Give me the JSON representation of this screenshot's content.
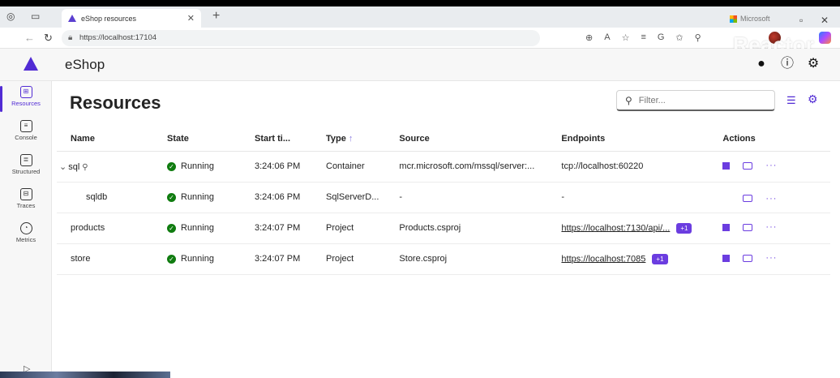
{
  "browser": {
    "tab_title": "eShop resources",
    "url": "https://localhost:17104",
    "profile_label": "Microsoft",
    "watermark": "Reactor"
  },
  "app": {
    "title": "eShop"
  },
  "nav": {
    "items": [
      {
        "label": "Resources",
        "icon": "grid-icon",
        "active": true
      },
      {
        "label": "Console",
        "icon": "console-icon",
        "active": false
      },
      {
        "label": "Structured",
        "icon": "structured-logs-icon",
        "active": false
      },
      {
        "label": "Traces",
        "icon": "traces-icon",
        "active": false
      },
      {
        "label": "Metrics",
        "icon": "metrics-icon",
        "active": false
      }
    ]
  },
  "page": {
    "title": "Resources",
    "filter_placeholder": "Filter..."
  },
  "table": {
    "headers": {
      "name": "Name",
      "state": "State",
      "start_time": "Start ti...",
      "type": "Type",
      "source": "Source",
      "endpoints": "Endpoints",
      "actions": "Actions"
    },
    "rows": [
      {
        "name": "sql",
        "state": "Running",
        "start": "3:24:06 PM",
        "type": "Container",
        "source": "mcr.microsoft.com/mssql/server:...",
        "endpoint": "tcp://localhost:60220",
        "endpoint_extra": ""
      },
      {
        "name": "sqldb",
        "state": "Running",
        "start": "3:24:06 PM",
        "type": "SqlServerD...",
        "source": "-",
        "endpoint": "-",
        "endpoint_extra": ""
      },
      {
        "name": "products",
        "state": "Running",
        "start": "3:24:07 PM",
        "type": "Project",
        "source": "Products.csproj",
        "endpoint": "https://localhost:7130/api/...",
        "endpoint_extra": "+1"
      },
      {
        "name": "store",
        "state": "Running",
        "start": "3:24:07 PM",
        "type": "Project",
        "source": "Store.csproj",
        "endpoint": "https://localhost:7085",
        "endpoint_extra": "+1"
      }
    ]
  },
  "colors": {
    "accent": "#512bd4",
    "running": "#107c10"
  }
}
